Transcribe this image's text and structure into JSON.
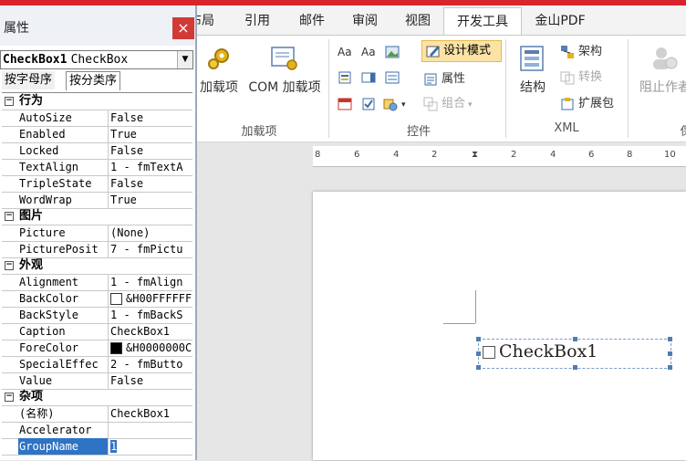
{
  "window": {
    "title": "属性",
    "close_glyph": "×"
  },
  "object_selector": {
    "name": "CheckBox1",
    "type": "CheckBox"
  },
  "property_tabs": [
    "按字母序",
    "按分类序"
  ],
  "categories": [
    {
      "label": "行为",
      "props": [
        {
          "name": "AutoSize",
          "value": "False"
        },
        {
          "name": "Enabled",
          "value": "True"
        },
        {
          "name": "Locked",
          "value": "False"
        },
        {
          "name": "TextAlign",
          "value": "1 - fmTextA"
        },
        {
          "name": "TripleState",
          "value": "False"
        },
        {
          "name": "WordWrap",
          "value": "True"
        }
      ]
    },
    {
      "label": "图片",
      "props": [
        {
          "name": "Picture",
          "value": "(None)"
        },
        {
          "name": "PicturePosit",
          "value": "7 - fmPictu"
        }
      ]
    },
    {
      "label": "外观",
      "props": [
        {
          "name": "Alignment",
          "value": "1 - fmAlign"
        },
        {
          "name": "BackColor",
          "value": "&H00FFFFFF",
          "swatch": "#ffffff"
        },
        {
          "name": "BackStyle",
          "value": "1 - fmBackS"
        },
        {
          "name": "Caption",
          "value": "CheckBox1"
        },
        {
          "name": "ForeColor",
          "value": "&H0000000C",
          "swatch": "#000000"
        },
        {
          "name": "SpecialEffec",
          "value": "2 - fmButto"
        },
        {
          "name": "Value",
          "value": "False"
        }
      ]
    },
    {
      "label": "杂项",
      "props": [
        {
          "name": "(名称)",
          "value": "CheckBox1"
        },
        {
          "name": "Accelerator",
          "value": ""
        },
        {
          "name": "GroupName",
          "value": "1",
          "selected": true
        }
      ]
    }
  ],
  "ribbon_tabs": [
    {
      "label": "布局"
    },
    {
      "label": "引用"
    },
    {
      "label": "邮件"
    },
    {
      "label": "审阅"
    },
    {
      "label": "视图"
    },
    {
      "label": "开发工具",
      "active": true
    },
    {
      "label": "金山PDF"
    }
  ],
  "ribbon": {
    "addins": {
      "addin_label": "加载项",
      "com_label": "COM 加载项",
      "group_label": "加载项"
    },
    "controls": {
      "design_mode": "设计模式",
      "properties": "属性",
      "group": "组合",
      "group_label": "控件",
      "aa1": "Aa",
      "aa2": "Aa"
    },
    "xml": {
      "structure": "结构",
      "schema": "架构",
      "transform": "转换",
      "expansion": "扩展包",
      "group_label": "XML"
    },
    "protect": {
      "block_authors": "阻止作者",
      "group_label_partial": "保"
    }
  },
  "ruler": {
    "ticks": [
      "8",
      "6",
      "4",
      "2",
      "",
      "2",
      "4",
      "6",
      "8",
      "10"
    ]
  },
  "document": {
    "checkbox_caption": "CheckBox1"
  },
  "colors": {
    "accent_red": "#d9242b",
    "selection_blue": "#2f73c4",
    "design_mode_bg": "#fbe3a6"
  }
}
